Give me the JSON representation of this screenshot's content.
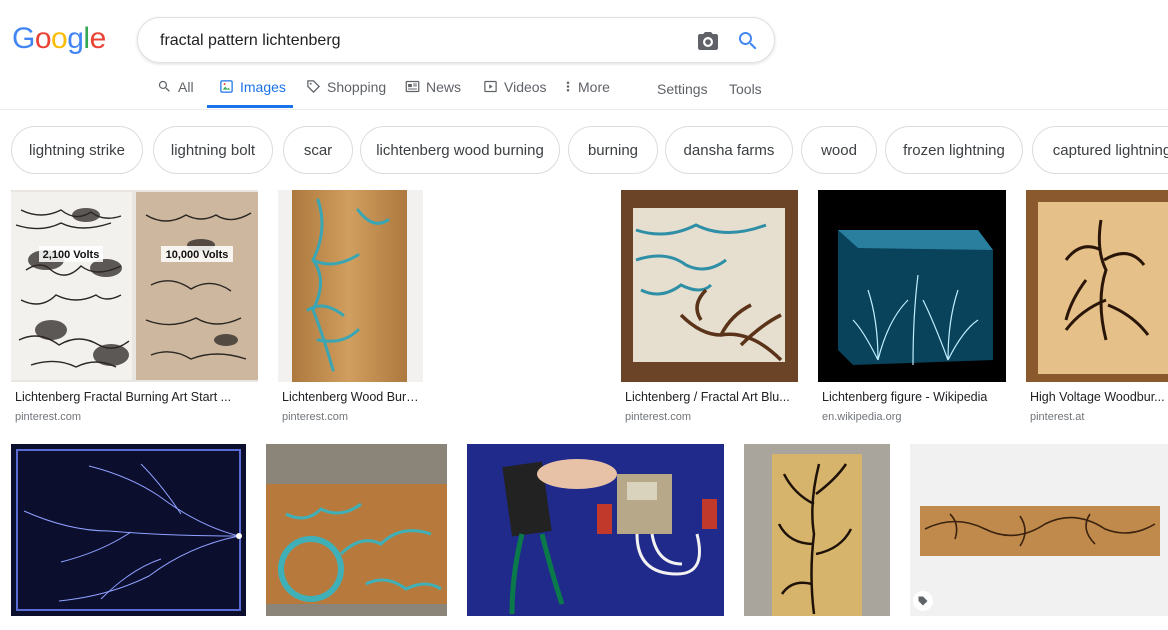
{
  "logo": {
    "letters": [
      "G",
      "o",
      "o",
      "g",
      "l",
      "e"
    ],
    "colors": [
      "#4285F4",
      "#EA4335",
      "#FBBC05",
      "#4285F4",
      "#34A853",
      "#EA4335"
    ]
  },
  "search": {
    "query": "fractal pattern lichtenberg",
    "camera_icon": "camera-icon",
    "search_icon": "search-icon"
  },
  "tabs": [
    {
      "label": "All",
      "icon": "search-icon"
    },
    {
      "label": "Images",
      "icon": "image-icon"
    },
    {
      "label": "Shopping",
      "icon": "tag-icon"
    },
    {
      "label": "News",
      "icon": "news-icon"
    },
    {
      "label": "Videos",
      "icon": "play-icon"
    },
    {
      "label": "More",
      "icon": "more-dots-icon"
    },
    {
      "label": "Settings"
    },
    {
      "label": "Tools"
    }
  ],
  "chips": [
    "lightning strike",
    "lightning bolt",
    "scar",
    "lichtenberg wood burning",
    "burning",
    "dansha farms",
    "wood",
    "frozen lightning",
    "captured lightning"
  ],
  "results": [
    {
      "caption": "Lichtenberg Fractal Burning Art Start ...",
      "source": "pinterest.com",
      "labels": [
        "2,100 Volts",
        "10,000 Volts"
      ]
    },
    {
      "caption": "Lichtenberg Wood Burn...",
      "source": "pinterest.com"
    },
    {
      "caption": "Lichtenberg / Fractal Art Blu...",
      "source": "pinterest.com"
    },
    {
      "caption": "Lichtenberg figure - Wikipedia",
      "source": "en.wikipedia.org"
    },
    {
      "caption": "High Voltage Woodbur...",
      "source": "pinterest.at"
    },
    {
      "caption": "",
      "source": ""
    },
    {
      "caption": "",
      "source": ""
    },
    {
      "caption": "",
      "source": ""
    },
    {
      "caption": "",
      "source": ""
    },
    {
      "caption": "",
      "source": ""
    }
  ],
  "colors": {
    "accent": "#1a73e8",
    "muted": "#5f6368"
  }
}
